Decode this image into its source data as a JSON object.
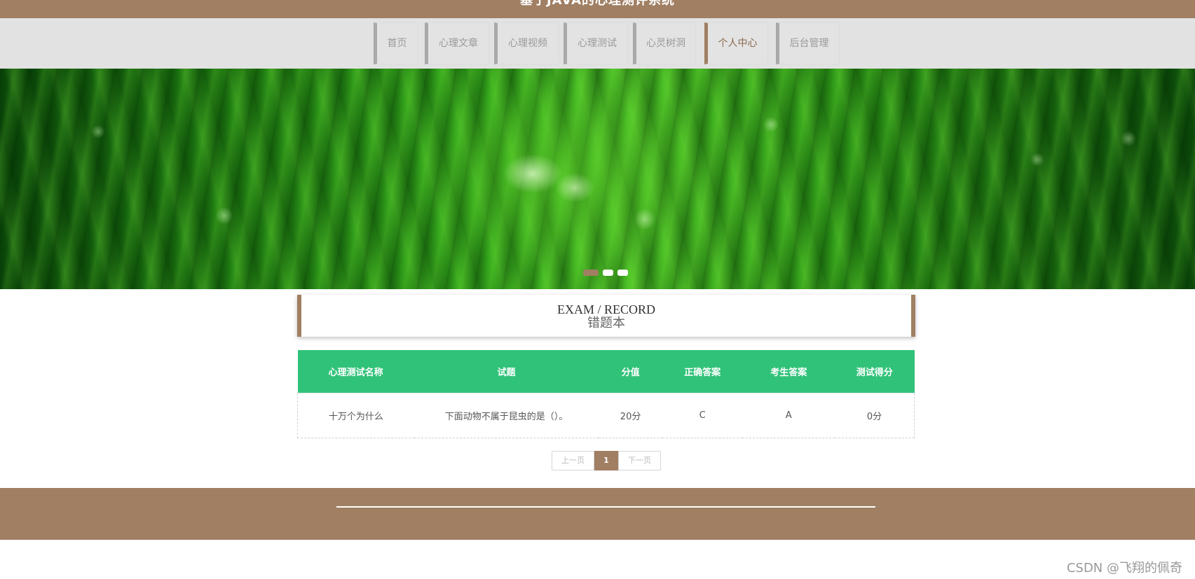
{
  "header": {
    "title": "基于JAVA的心理测评系统"
  },
  "nav": {
    "items": [
      {
        "label": "首页"
      },
      {
        "label": "心理文章"
      },
      {
        "label": "心理视频"
      },
      {
        "label": "心理测试"
      },
      {
        "label": "心灵树洞"
      },
      {
        "label": "个人中心"
      },
      {
        "label": "后台管理"
      }
    ],
    "active": "个人中心"
  },
  "banner": {
    "slides": 3,
    "active_slide": 1,
    "colors": {
      "dot_active": "#a07f63",
      "dot": "#ffffff"
    }
  },
  "section": {
    "title_en": "EXAM / RECORD",
    "title_cn": "错题本"
  },
  "table": {
    "headers": [
      "心理测试名称",
      "试题",
      "分值",
      "正确答案",
      "考生答案",
      "测试得分"
    ],
    "rows": [
      [
        "十万个为什么",
        "下面动物不属于昆虫的是（）。",
        "20分",
        "C",
        "A",
        "0分"
      ]
    ]
  },
  "pager": {
    "prev": "上一页",
    "current": "1",
    "next": "下一页"
  },
  "watermark": "CSDN @飞翔的佩奇",
  "colors": {
    "brand": "#a07f63",
    "table_header": "#31c27a",
    "nav_bg": "#e2e2e2"
  }
}
